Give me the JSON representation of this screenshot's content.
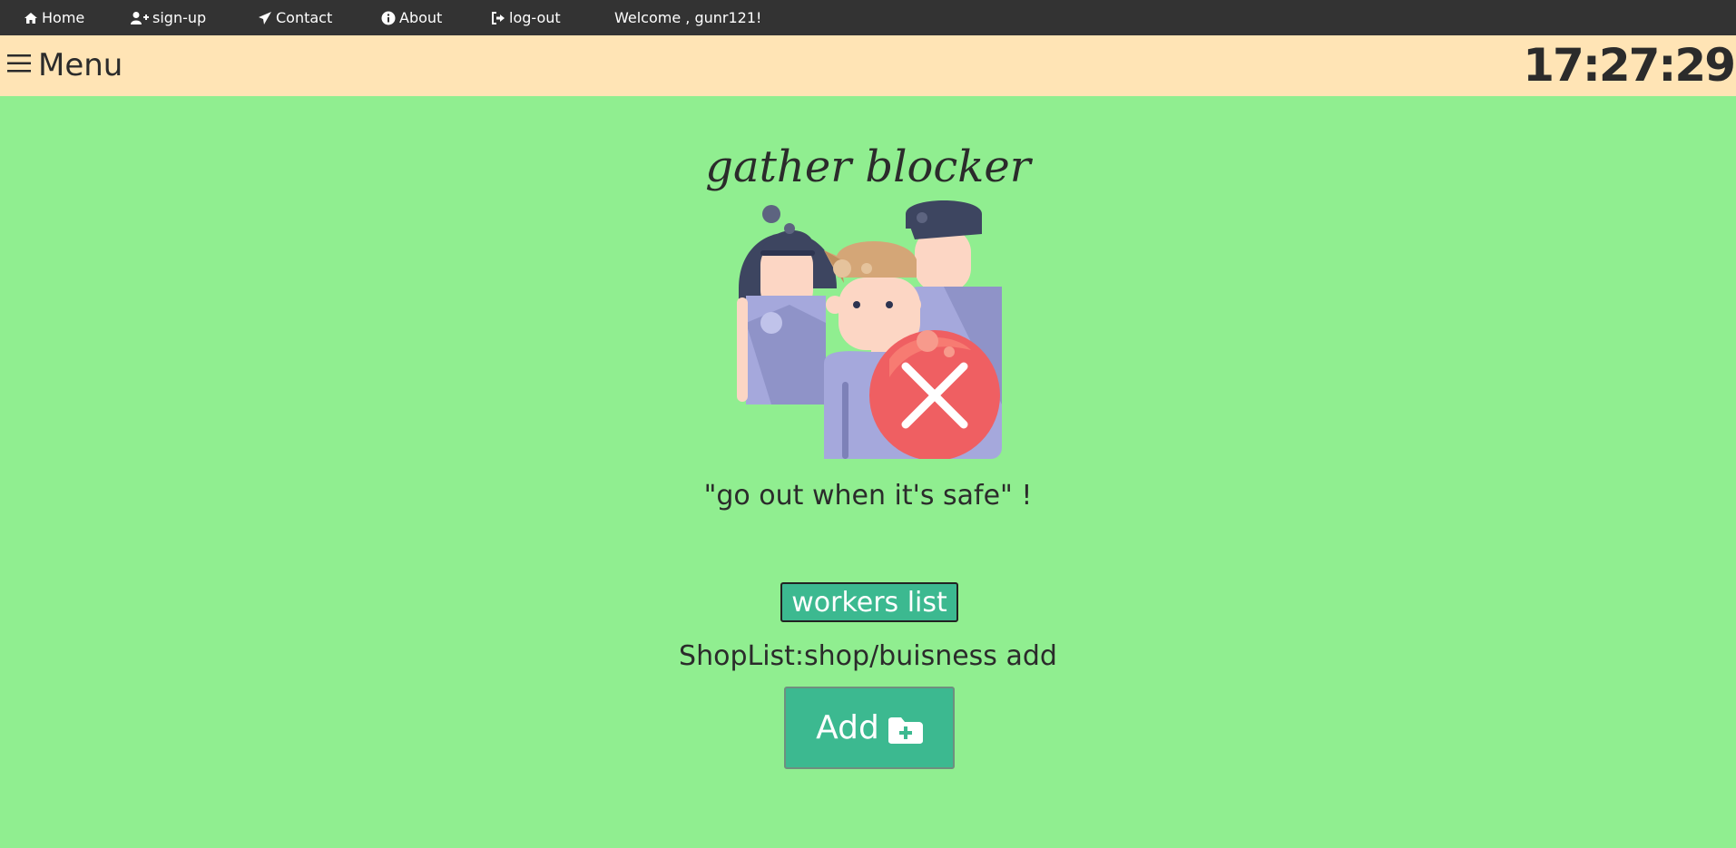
{
  "nav": {
    "home": {
      "label": "Home",
      "icon": "home-icon"
    },
    "signup": {
      "label": "sign-up",
      "icon": "user-plus-icon"
    },
    "contact": {
      "label": "Contact",
      "icon": "paper-plane-icon"
    },
    "about": {
      "label": "About",
      "icon": "info-circle-icon"
    },
    "logout": {
      "label": "log-out",
      "icon": "sign-out-icon"
    },
    "welcome": "Welcome , gunr121!"
  },
  "menubar": {
    "menu_label": "Menu",
    "menu_icon": "hamburger-icon",
    "clock": "17:27:29"
  },
  "main": {
    "title": "gather blocker",
    "illustration": "crowd-blocked-illustration",
    "slogan": "\"go out when it's safe\" !",
    "workers_button": "workers list",
    "shoplist_label": "ShopList:shop/buisness add",
    "add_button": "Add",
    "add_icon": "folder-plus-icon"
  },
  "colors": {
    "page_bg": "#90ee90",
    "topnav_bg": "#333333",
    "menubar_bg": "#ffe4b5",
    "button_bg": "#3cb990",
    "text": "#2b2b2b"
  }
}
